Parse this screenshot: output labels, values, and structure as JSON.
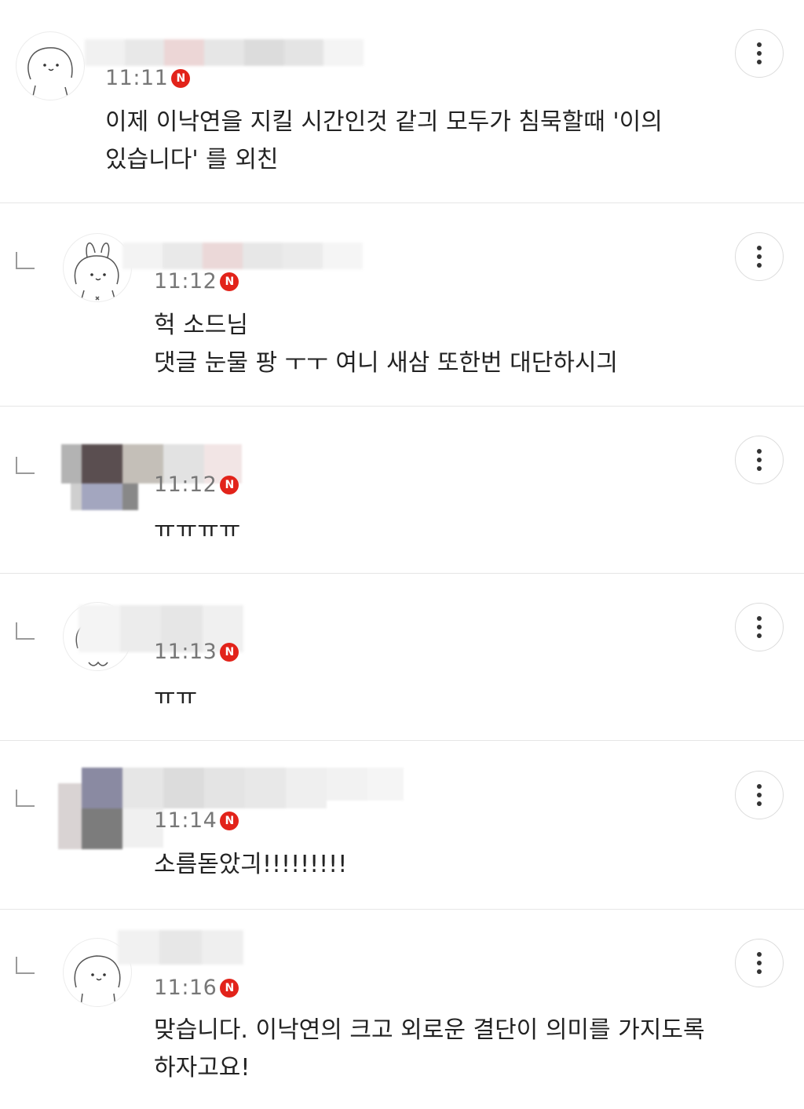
{
  "comments": [
    {
      "time": "11:11",
      "badge": "N",
      "lines": [
        "이제 이낙연을 지킬 시간인것 같긔 모두가 침묵할때 '이의",
        "있습니다' 를 외친"
      ],
      "avatar_icon": "bunny-face-icon"
    },
    {
      "time": "11:12",
      "badge": "N",
      "lines": [
        "헉 소드님",
        "댓글 눈물 팡 ㅜㅜ 여니 새삼 또한번 대단하시긔"
      ],
      "avatar_icon": "bunny-ears-icon"
    },
    {
      "time": "11:12",
      "badge": "N",
      "lines": [
        "ㅠㅠㅠㅠ"
      ],
      "avatar_icon": "pixelated-avatar-icon"
    },
    {
      "time": "11:13",
      "badge": "N",
      "lines": [
        "ㅠㅠ"
      ],
      "avatar_icon": "bunny-face-icon"
    },
    {
      "time": "11:14",
      "badge": "N",
      "lines": [
        "소름돋았긔!!!!!!!!!"
      ],
      "avatar_icon": "pixelated-avatar-icon"
    },
    {
      "time": "11:16",
      "badge": "N",
      "lines": [
        "맞습니다. 이낙연의 크고 외로운 결단이 의미를 가지도록",
        "하자고요!"
      ],
      "avatar_icon": "bunny-face-icon"
    }
  ],
  "colors": {
    "badge": "#e2231a",
    "time": "#777777",
    "text": "#222222",
    "divider": "#e6e6e6"
  }
}
